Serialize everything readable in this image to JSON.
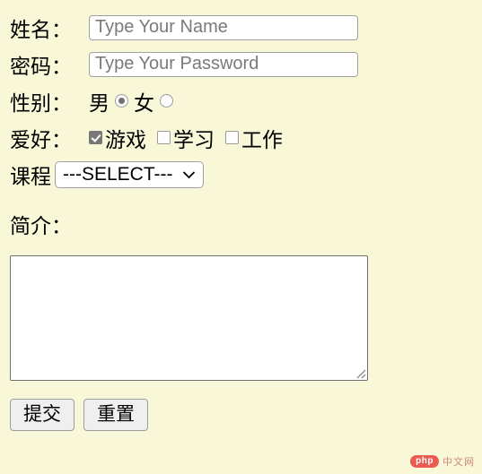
{
  "page": {
    "background_color": "#f8f8d8"
  },
  "form": {
    "fields": {
      "name": {
        "label": "姓名：",
        "placeholder": "Type Your Name",
        "value": ""
      },
      "password": {
        "label": "密码：",
        "placeholder": "Type Your Password",
        "value": ""
      },
      "gender": {
        "label": "性别：",
        "options": [
          {
            "label": "男",
            "selected": true
          },
          {
            "label": "女",
            "selected": false
          }
        ]
      },
      "hobby": {
        "label": "爱好：",
        "options": [
          {
            "label": "游戏",
            "checked": true
          },
          {
            "label": "学习",
            "checked": false
          },
          {
            "label": "工作",
            "checked": false
          }
        ]
      },
      "course": {
        "label": "课程",
        "selected": "---SELECT---",
        "caret_icon": "chevron-down-icon"
      },
      "intro": {
        "label": "简介：",
        "value": ""
      }
    },
    "buttons": {
      "submit": "提交",
      "reset": "重置"
    }
  },
  "watermark": {
    "badge": "php",
    "text": "中文网",
    "badge_color": "#e8413a"
  }
}
